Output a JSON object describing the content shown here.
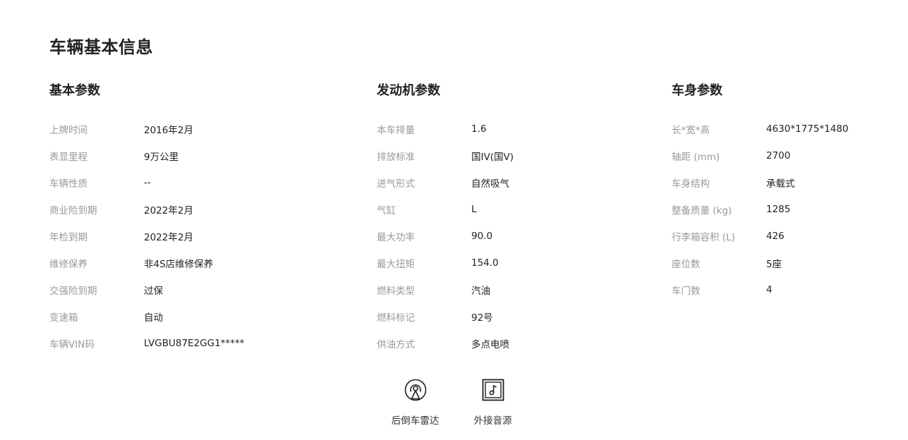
{
  "page": {
    "title": "车辆基本信息"
  },
  "sections": {
    "basic": {
      "title": "基本参数",
      "rows": [
        {
          "label": "上牌时间",
          "value": "2016年2月"
        },
        {
          "label": "表显里程",
          "value": "9万公里"
        },
        {
          "label": "车辆性质",
          "value": "--"
        },
        {
          "label": "商业险到期",
          "value": "2022年2月"
        },
        {
          "label": "年检到期",
          "value": "2022年2月"
        },
        {
          "label": "维修保养",
          "value": "非4S店维修保养"
        },
        {
          "label": "交强险到期",
          "value": "过保"
        },
        {
          "label": "变速箱",
          "value": "自动"
        },
        {
          "label": "车辆VIN码",
          "value": "LVGBU87E2GG1*****"
        }
      ]
    },
    "engine": {
      "title": "发动机参数",
      "rows": [
        {
          "label": "本车排量",
          "value": "1.6"
        },
        {
          "label": "排放标准",
          "value": "国IV(国V)"
        },
        {
          "label": "进气形式",
          "value": "自然吸气"
        },
        {
          "label": "气缸",
          "value": "L"
        },
        {
          "label": "最大功率",
          "value": "90.0"
        },
        {
          "label": "最大扭矩",
          "value": "154.0"
        },
        {
          "label": "燃料类型",
          "value": "汽油"
        },
        {
          "label": "燃料标记",
          "value": "92号"
        },
        {
          "label": "供油方式",
          "value": "多点电喷"
        }
      ]
    },
    "body": {
      "title": "车身参数",
      "rows": [
        {
          "label": "长*宽*高",
          "value": "4630*1775*1480"
        },
        {
          "label": "轴距 (mm)",
          "value": "2700"
        },
        {
          "label": "车身结构",
          "value": "承载式"
        },
        {
          "label": "整备质量 (kg)",
          "value": "1285"
        },
        {
          "label": "行李箱容积 (L)",
          "value": "426"
        },
        {
          "label": "座位数",
          "value": "5座"
        },
        {
          "label": "车门数",
          "value": "4"
        }
      ]
    }
  },
  "features": [
    {
      "label": "后倒车雷达",
      "icon": "radar-icon"
    },
    {
      "label": "外接音源",
      "icon": "music-source-icon"
    }
  ]
}
